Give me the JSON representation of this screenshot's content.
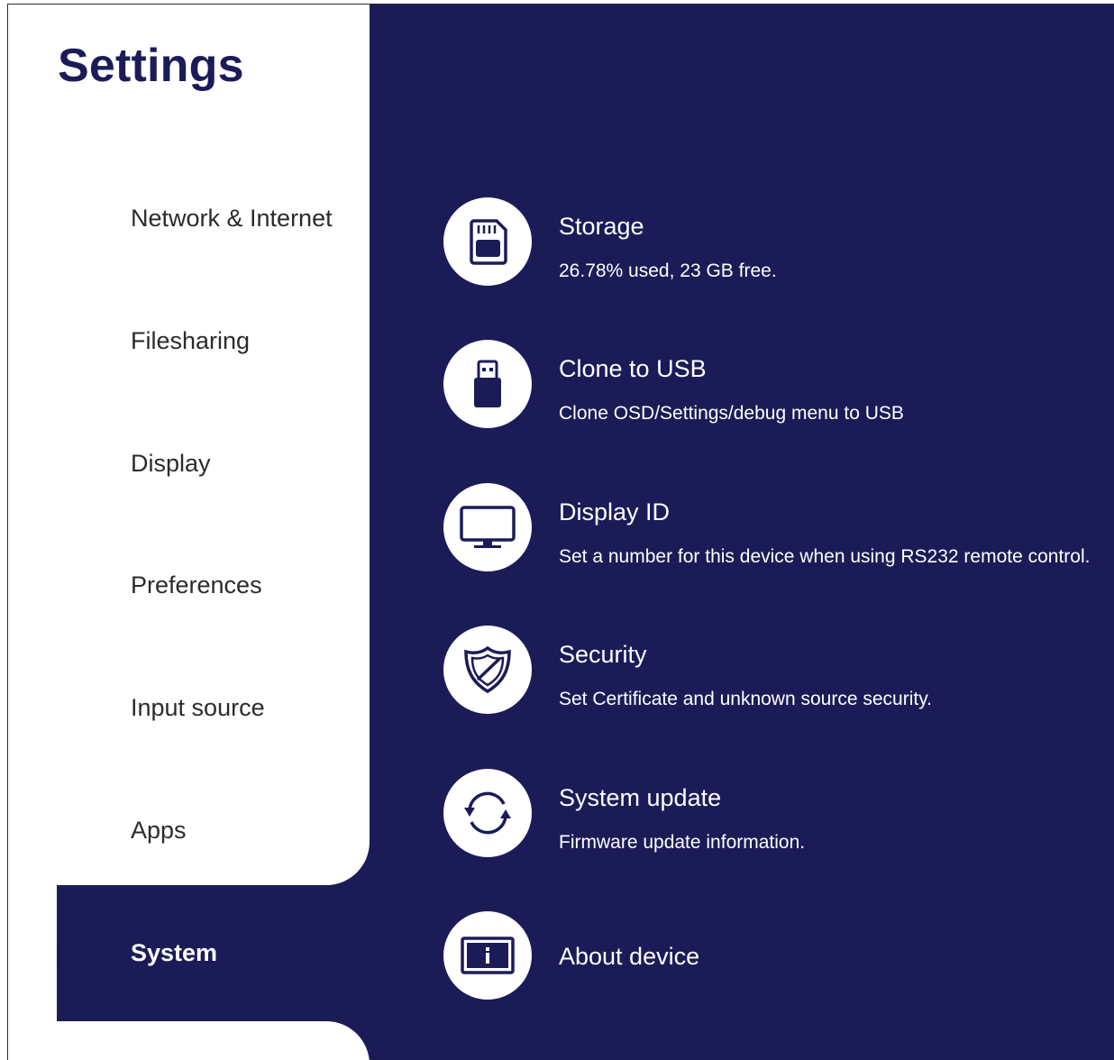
{
  "app": {
    "title": "Settings"
  },
  "sidebar": {
    "items": [
      {
        "label": "Network & Internet"
      },
      {
        "label": "Filesharing"
      },
      {
        "label": "Display"
      },
      {
        "label": "Preferences"
      },
      {
        "label": "Input source"
      },
      {
        "label": "Apps"
      },
      {
        "label": "System",
        "selected": true
      }
    ]
  },
  "main": {
    "items": [
      {
        "title": "Storage",
        "description": "26.78% used, 23 GB free.",
        "icon": "sd-card-icon"
      },
      {
        "title": "Clone to USB",
        "description": "Clone OSD/Settings/debug menu to USB",
        "icon": "usb-drive-icon"
      },
      {
        "title": "Display ID",
        "description": "Set a number for this device when using RS232 remote control.",
        "icon": "monitor-icon"
      },
      {
        "title": "Security",
        "description": "Set Certificate and unknown source security.",
        "icon": "shield-icon"
      },
      {
        "title": "System update",
        "description": "Firmware update information.",
        "icon": "sync-icon"
      },
      {
        "title": "About device",
        "description": "",
        "icon": "info-icon"
      }
    ]
  },
  "colors": {
    "accent": "#1b1c57",
    "panel": "#ffffff",
    "text_dark": "#2b2b2b"
  }
}
